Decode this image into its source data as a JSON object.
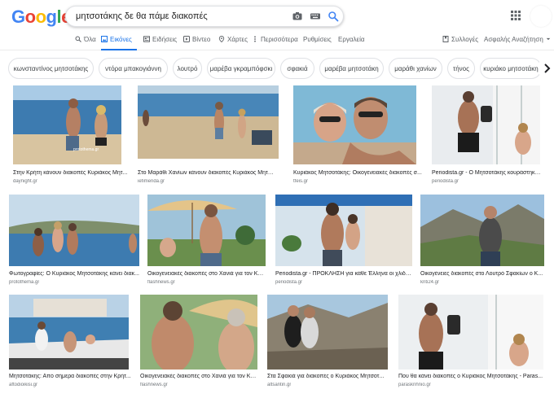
{
  "search": {
    "query": "μητσοτάκης δε θα πάμε διακοπές"
  },
  "tabs": [
    {
      "label": "Όλα",
      "icon": "search-icon"
    },
    {
      "label": "Εικόνες",
      "icon": "image-icon"
    },
    {
      "label": "Ειδήσεις",
      "icon": "news-icon"
    },
    {
      "label": "Βίντεο",
      "icon": "video-icon"
    },
    {
      "label": "Χάρτες",
      "icon": "map-pin-icon"
    },
    {
      "label": "Περισσότερα",
      "icon": "more-icon"
    },
    {
      "label": "Ρυθμίσεις"
    },
    {
      "label": "Εργαλεία"
    }
  ],
  "right_links": {
    "collections": "Συλλογές",
    "safesearch": "Ασφαλής Αναζήτηση"
  },
  "chips": [
    "κωνσταντίνος μητσοτάκης",
    "ντόρα μπακογιάννη",
    "λουτρό",
    "μαρέβα γκραμπόφσκι",
    "σφακιά",
    "μαρέβα μητσοτάκη",
    "μαράθι χανίων",
    "τήνος",
    "κυριάκο μητσοτάκη"
  ],
  "results": [
    {
      "title": "Στην Κρήτη κάνουν διακοπές Κυριάκος Μητ...",
      "source": "daynight.gr",
      "scene": "beach",
      "watermark": "protothema.gr"
    },
    {
      "title": "Στο Μαράθι Χανίων κάνουν διακοπές Κυριάκος Μητσοτά...",
      "source": "iefimerida.gr",
      "scene": "beach2"
    },
    {
      "title": "Κυριάκος Μητσοτάκης: Οικογενειακές διακοπές σ...",
      "source": "tfeis.gr",
      "scene": "selfie"
    },
    {
      "title": "Periodista.gr - Ο Μητσοτάκης κουράστηκε ...",
      "source": "periodista.gr",
      "scene": "boat"
    },
    {
      "title": "Φωτογραφίες: Ο Κυριάκος Μητσοτάκης κάνει διακ...",
      "source": "protothema.gr",
      "scene": "sea"
    },
    {
      "title": "Οικογενειακές διακοπές στο Χανιά για τον Κυ...",
      "source": "flashnews.gr",
      "scene": "umbrella"
    },
    {
      "title": "Periodista.gr - ΠΡΟΚΛΗΣΗ για κάθε Έλληνα οι χλιδάτ...",
      "source": "periodista.gr",
      "scene": "terrace"
    },
    {
      "title": "Οικογένειες διακοπές στο Λουτρό Σφακίων ο Κ...",
      "source": "kriti24.gr",
      "scene": "mountain"
    },
    {
      "title": "Μητσοτάκης: Από σήμερα διακοπές στην Κρήτ...",
      "source": "aftodioikisi.gr",
      "scene": "harbor"
    },
    {
      "title": "Οικογενειακές διακοπές στο Χανιά για τον Κυ...",
      "source": "flashnews.gr",
      "scene": "closeup"
    },
    {
      "title": "Στα Σφακιά για διακοπές ο Κυριάκος Μητσοτ...",
      "source": "altsantiri.gr",
      "scene": "hill"
    },
    {
      "title": "Που θα κάνει διακοπές ο Κυριάκος Μητσοτάκης - Paras...",
      "source": "parasknhnio.gr",
      "scene": "boat2"
    }
  ],
  "colors": {
    "accent": "#1a73e8",
    "sea": "#3d7bb0",
    "sand": "#d8c4a0",
    "sky": "#a9cbe6"
  }
}
